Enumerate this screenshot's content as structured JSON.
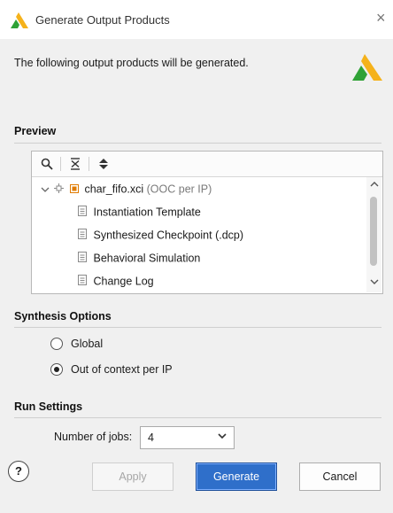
{
  "window": {
    "title": "Generate Output Products",
    "close_label": "×"
  },
  "intro_text": "The following output products will be generated.",
  "preview": {
    "section_title": "Preview",
    "toolbar": [
      "search-icon",
      "collapse-all-icon",
      "expand-all-icon"
    ],
    "root": {
      "name": "char_fifo.xci",
      "suffix": "(OOC per IP)"
    },
    "children": [
      "Instantiation Template",
      "Synthesized Checkpoint (.dcp)",
      "Behavioral Simulation",
      "Change Log"
    ]
  },
  "synthesis_options": {
    "section_title": "Synthesis Options",
    "options": [
      {
        "label": "Global",
        "selected": false
      },
      {
        "label": "Out of context per IP",
        "selected": true
      }
    ]
  },
  "run_settings": {
    "section_title": "Run Settings",
    "jobs_label": "Number of jobs:",
    "jobs_value": "4"
  },
  "buttons": {
    "help": "?",
    "apply": "Apply",
    "generate": "Generate",
    "cancel": "Cancel"
  },
  "colors": {
    "brand_green": "#33a02c",
    "brand_yellow": "#f5b21b",
    "primary": "#2f6fca",
    "root_icon": "#e07b00"
  }
}
